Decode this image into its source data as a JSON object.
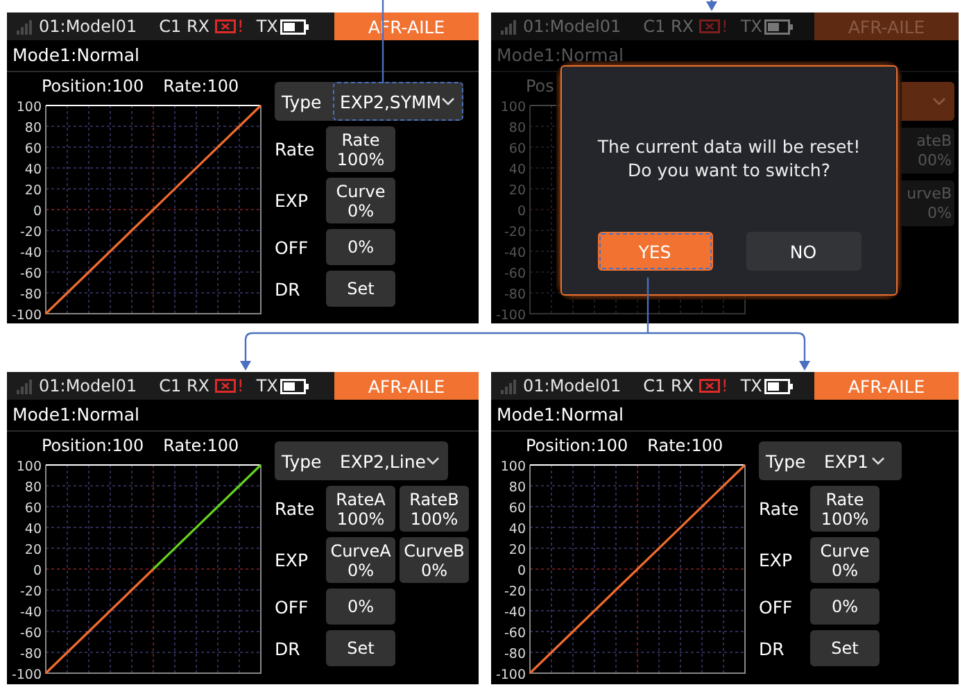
{
  "screens": [
    {
      "kind": "editor",
      "status_bar": {
        "model": "01:Model01",
        "rx": "C1 RX",
        "alert": "!",
        "tx": "TX",
        "title": "AFR-AILE"
      },
      "mode": "Mode1:Normal",
      "chart_header": [
        "Position:100",
        "Rate:100"
      ],
      "chart_data": {
        "type": "line",
        "categories": [
          null,
          null,
          null
        ],
        "ylim": [
          -100,
          100
        ],
        "yticks": [
          100,
          80,
          60,
          40,
          20,
          0,
          -20,
          -40,
          -60,
          -80,
          -100
        ],
        "grid": true,
        "series": [
          {
            "color": "#f26b2e",
            "values": [
              -100,
              0,
              100
            ]
          }
        ]
      },
      "controls": [
        {
          "kind": "dropdown",
          "label": "Type",
          "value": "EXP2,SYMM",
          "highlighted": true
        },
        {
          "kind": "buttons",
          "label": "Rate",
          "buttons": [
            {
              "lines": [
                "Rate",
                "100%"
              ]
            }
          ]
        },
        {
          "kind": "buttons",
          "label": "EXP",
          "buttons": [
            {
              "lines": [
                "Curve",
                "0%"
              ]
            }
          ]
        },
        {
          "kind": "buttons",
          "label": "OFF",
          "buttons": [
            {
              "lines": [
                "0%"
              ]
            }
          ]
        },
        {
          "kind": "buttons",
          "label": "DR",
          "buttons": [
            {
              "lines": [
                "Set"
              ]
            }
          ]
        }
      ]
    },
    {
      "kind": "dialog",
      "status_bar": {
        "model": "01:Model01",
        "rx": "C1 RX",
        "alert": "!",
        "tx": "TX",
        "title": "AFR-AILE"
      },
      "mode": "Mode1:Normal",
      "chart_header": [
        "Pos"
      ],
      "y_labels": [
        "100",
        "80",
        "60",
        "40",
        "20",
        "0",
        "-20",
        "-40",
        "-60",
        "-80",
        "-100"
      ],
      "peek": [
        {
          "lines": [
            "ateB",
            "00%"
          ]
        },
        {
          "lines": [
            "urveB",
            "0%"
          ]
        }
      ],
      "dialog": {
        "message": "The current data will be reset!\nDo you want to switch?",
        "buttons": [
          {
            "label": "YES",
            "highlighted": true
          },
          {
            "label": "NO",
            "highlighted": false
          }
        ]
      }
    },
    {
      "kind": "editor",
      "status_bar": {
        "model": "01:Model01",
        "rx": "C1 RX",
        "alert": "!",
        "tx": "TX",
        "title": "AFR-AILE"
      },
      "mode": "Mode1:Normal",
      "chart_header": [
        "Position:100",
        "Rate:100"
      ],
      "chart_data": {
        "type": "line",
        "categories": [
          null,
          null,
          null
        ],
        "ylim": [
          -100,
          100
        ],
        "yticks": [
          100,
          80,
          60,
          40,
          20,
          0,
          -20,
          -40,
          -60,
          -80,
          -100
        ],
        "grid": true,
        "series": [
          {
            "color": "#f26b2e",
            "values": [
              -100,
              0,
              null
            ]
          },
          {
            "color": "#66d41e",
            "values": [
              null,
              0,
              100
            ]
          }
        ]
      },
      "controls": [
        {
          "kind": "dropdown",
          "label": "Type",
          "value": "EXP2,Line",
          "highlighted": false
        },
        {
          "kind": "buttons",
          "label": "Rate",
          "buttons": [
            {
              "lines": [
                "RateA",
                "100%"
              ]
            },
            {
              "lines": [
                "RateB",
                "100%"
              ]
            }
          ]
        },
        {
          "kind": "buttons",
          "label": "EXP",
          "buttons": [
            {
              "lines": [
                "CurveA",
                "0%"
              ]
            },
            {
              "lines": [
                "CurveB",
                "0%"
              ]
            }
          ]
        },
        {
          "kind": "buttons",
          "label": "OFF",
          "buttons": [
            {
              "lines": [
                "0%"
              ]
            }
          ]
        },
        {
          "kind": "buttons",
          "label": "DR",
          "buttons": [
            {
              "lines": [
                "Set"
              ]
            }
          ]
        }
      ]
    },
    {
      "kind": "editor",
      "status_bar": {
        "model": "01:Model01",
        "rx": "C1 RX",
        "alert": "!",
        "tx": "TX",
        "title": "AFR-AILE"
      },
      "mode": "Mode1:Normal",
      "chart_header": [
        "Position:100",
        "Rate:100"
      ],
      "chart_data": {
        "type": "line",
        "categories": [
          null,
          null,
          null
        ],
        "ylim": [
          -100,
          100
        ],
        "yticks": [
          100,
          80,
          60,
          40,
          20,
          0,
          -20,
          -40,
          -60,
          -80,
          -100
        ],
        "grid": true,
        "series": [
          {
            "color": "#f26b2e",
            "values": [
              -100,
              0,
              100
            ]
          }
        ]
      },
      "controls": [
        {
          "kind": "dropdown",
          "label": "Type",
          "value": "EXP1",
          "highlighted": false
        },
        {
          "kind": "buttons",
          "label": "Rate",
          "buttons": [
            {
              "lines": [
                "Rate",
                "100%"
              ]
            }
          ]
        },
        {
          "kind": "buttons",
          "label": "EXP",
          "buttons": [
            {
              "lines": [
                "Curve",
                "0%"
              ]
            }
          ]
        },
        {
          "kind": "buttons",
          "label": "OFF",
          "buttons": [
            {
              "lines": [
                "0%"
              ]
            }
          ]
        },
        {
          "kind": "buttons",
          "label": "DR",
          "buttons": [
            {
              "lines": [
                "Set"
              ]
            }
          ]
        }
      ]
    }
  ]
}
